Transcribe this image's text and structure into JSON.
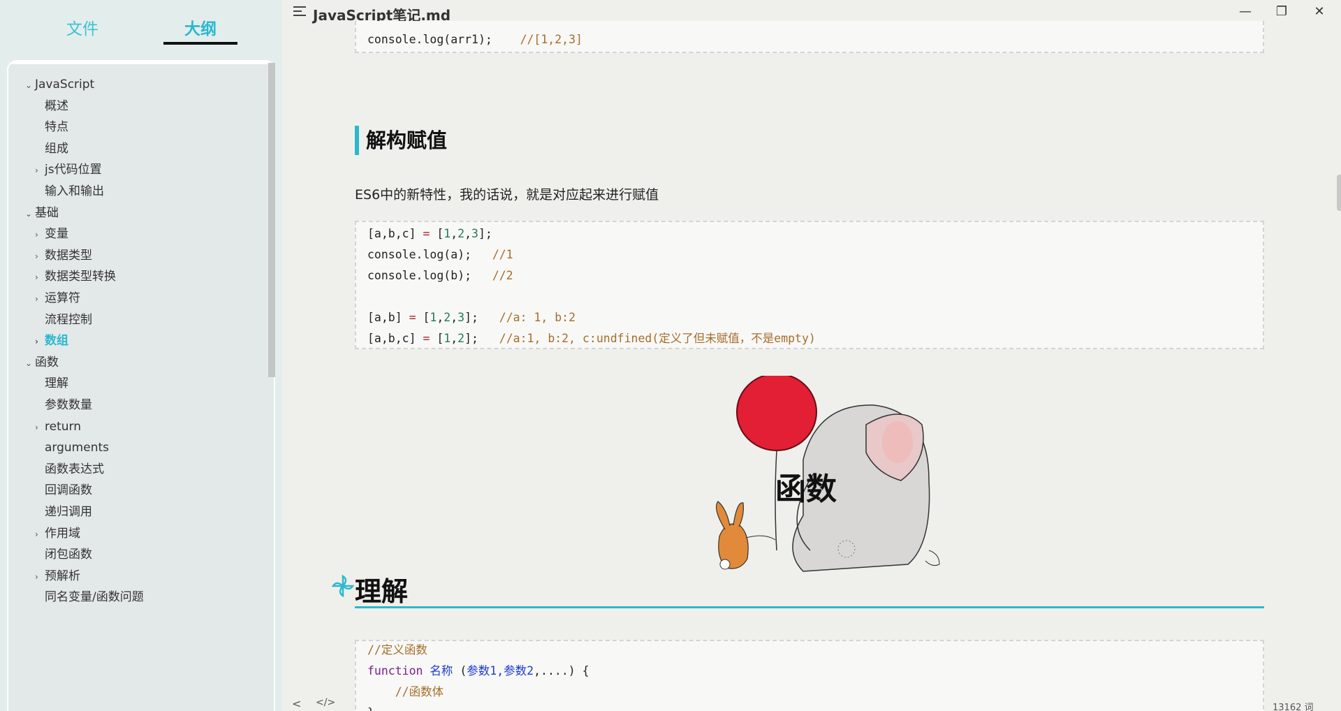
{
  "sidebar": {
    "tabs": {
      "files": "文件",
      "outline": "大纲"
    },
    "outline": [
      {
        "label": "JavaScript",
        "level": 0,
        "expanded": true
      },
      {
        "label": "概述",
        "level": 1
      },
      {
        "label": "特点",
        "level": 1
      },
      {
        "label": "组成",
        "level": 1
      },
      {
        "label": "js代码位置",
        "level": 1,
        "collapsed": true
      },
      {
        "label": "输入和输出",
        "level": 1
      },
      {
        "label": "基础",
        "level": 0,
        "expanded": true
      },
      {
        "label": "变量",
        "level": 1,
        "collapsed": true
      },
      {
        "label": "数据类型",
        "level": 1,
        "collapsed": true
      },
      {
        "label": "数据类型转换",
        "level": 1,
        "collapsed": true
      },
      {
        "label": "运算符",
        "level": 1,
        "collapsed": true
      },
      {
        "label": "流程控制",
        "level": 1
      },
      {
        "label": "数组",
        "level": 1,
        "collapsed": true,
        "active": true
      },
      {
        "label": "函数",
        "level": 0,
        "expanded": true
      },
      {
        "label": "理解",
        "level": 1
      },
      {
        "label": "参数数量",
        "level": 1
      },
      {
        "label": "return",
        "level": 1,
        "collapsed": true
      },
      {
        "label": "arguments",
        "level": 1
      },
      {
        "label": "函数表达式",
        "level": 1
      },
      {
        "label": "回调函数",
        "level": 1
      },
      {
        "label": "递归调用",
        "level": 1
      },
      {
        "label": "作用域",
        "level": 1,
        "collapsed": true
      },
      {
        "label": "闭包函数",
        "level": 1
      },
      {
        "label": "预解析",
        "level": 1,
        "collapsed": true
      },
      {
        "label": "同名变量/函数问题",
        "level": 1
      }
    ]
  },
  "header": {
    "title": "JavaScript笔记.md",
    "menu_icon": "outline-toggle-icon",
    "min": "—",
    "max": "❐",
    "close": "✕"
  },
  "content": {
    "top_code": {
      "code": "console.log(arr1);",
      "comment": "//[1,2,3]"
    },
    "section_destructure": {
      "title": "解构赋值",
      "paragraph": "ES6中的新特性，我的话说，就是对应起来进行赋值",
      "lines": [
        {
          "code": "[a,b,c] = [1,2,3];",
          "comment": ""
        },
        {
          "code": "console.log(a);",
          "comment": "//1"
        },
        {
          "code": "console.log(b);",
          "comment": "//2"
        },
        {
          "code": "",
          "comment": ""
        },
        {
          "code": "[a,b] = [1,2,3];",
          "comment": "//a: 1, b:2"
        },
        {
          "code": "[a,b,c] = [1,2];",
          "comment": "//a:1, b:2, c:undfined(定义了但未赋值，不是empty)"
        }
      ]
    },
    "illustration": {
      "title": "函数"
    },
    "section_understand": {
      "title": "理解",
      "lines": [
        {
          "type": "comment",
          "text": "//定义函数"
        },
        {
          "type": "func",
          "kw": "function",
          "name": "名称",
          "params": "参数1,参数2,....",
          "open": " (",
          "close": ") {"
        },
        {
          "type": "comment",
          "text": "    //函数体"
        },
        {
          "type": "plain",
          "text": "}"
        }
      ]
    }
  },
  "footer": {
    "back": "<",
    "source": "</>",
    "word_count": "13162 词"
  },
  "colors": {
    "accent": "#2bb8cf",
    "sidebar_bg": "#e3eeec",
    "content_bg": "#eff0eb"
  }
}
